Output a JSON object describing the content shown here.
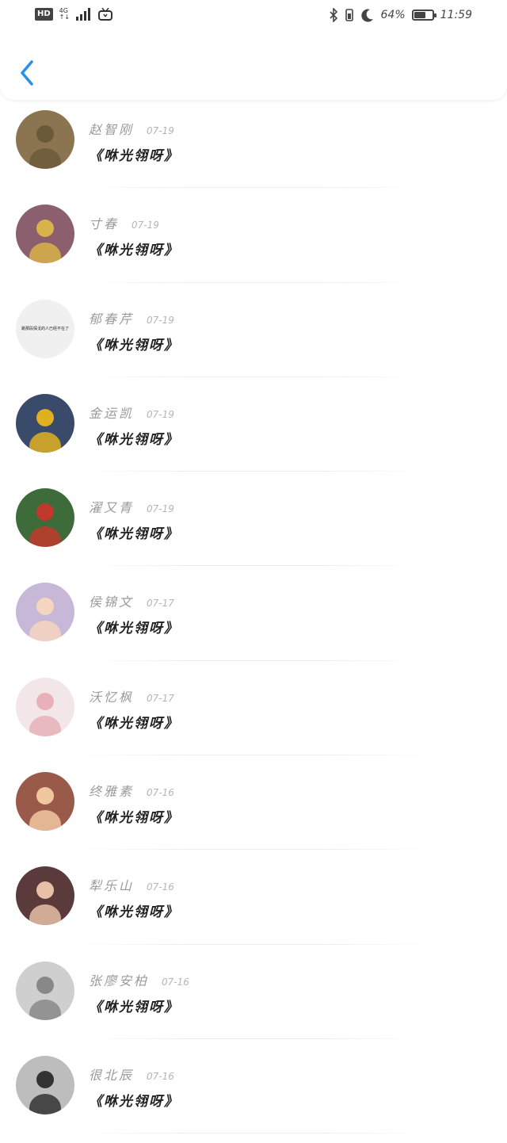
{
  "status_bar": {
    "hd": "HD",
    "network": "4G",
    "battery_percent": "64%",
    "battery_level": 0.64,
    "time": "11:59",
    "icons": [
      "signal-icon",
      "tv-icon",
      "bluetooth-icon",
      "vibrate-icon",
      "moon-icon",
      "battery-icon"
    ]
  },
  "header": {
    "back_icon": "chevron-left-icon",
    "accent": "#2a8fe6"
  },
  "contacts": [
    {
      "name": "赵智刚",
      "date": "07-19",
      "message": "《咻光翎呀》",
      "avatar_color": "#6b5a3a",
      "avatar_bg": "#8a7550"
    },
    {
      "name": "寸春",
      "date": "07-19",
      "message": "《咻光翎呀》",
      "avatar_color": "#d8b24a",
      "avatar_bg": "#8b5f6e"
    },
    {
      "name": "郁春芹",
      "date": "07-19",
      "message": "《咻光翎呀》",
      "avatar_color": "#222",
      "avatar_bg": "#f0f0f0",
      "avatar_text": "跳那段探戈的人已经不在了"
    },
    {
      "name": "金运凯",
      "date": "07-19",
      "message": "《咻光翎呀》",
      "avatar_color": "#e0b020",
      "avatar_bg": "#3a4a6a"
    },
    {
      "name": "濯又青",
      "date": "07-19",
      "message": "《咻光翎呀》",
      "avatar_color": "#c0392b",
      "avatar_bg": "#3e6b3a"
    },
    {
      "name": "侯锦文",
      "date": "07-17",
      "message": "《咻光翎呀》",
      "avatar_color": "#f5d5c0",
      "avatar_bg": "#c8b8d8"
    },
    {
      "name": "沃忆枫",
      "date": "07-17",
      "message": "《咻光翎呀》",
      "avatar_color": "#e8b0b8",
      "avatar_bg": "#f2e6e8"
    },
    {
      "name": "终雅素",
      "date": "07-16",
      "message": "《咻光翎呀》",
      "avatar_color": "#f0c8a0",
      "avatar_bg": "#9a5a4a"
    },
    {
      "name": "犁乐山",
      "date": "07-16",
      "message": "《咻光翎呀》",
      "avatar_color": "#e8c0a8",
      "avatar_bg": "#5a3a3a"
    },
    {
      "name": "张廖安柏",
      "date": "07-16",
      "message": "《咻光翎呀》",
      "avatar_color": "#888",
      "avatar_bg": "#cfcfcf"
    },
    {
      "name": "很北辰",
      "date": "07-16",
      "message": "《咻光翎呀》",
      "avatar_color": "#333",
      "avatar_bg": "#bdbdbd"
    }
  ]
}
